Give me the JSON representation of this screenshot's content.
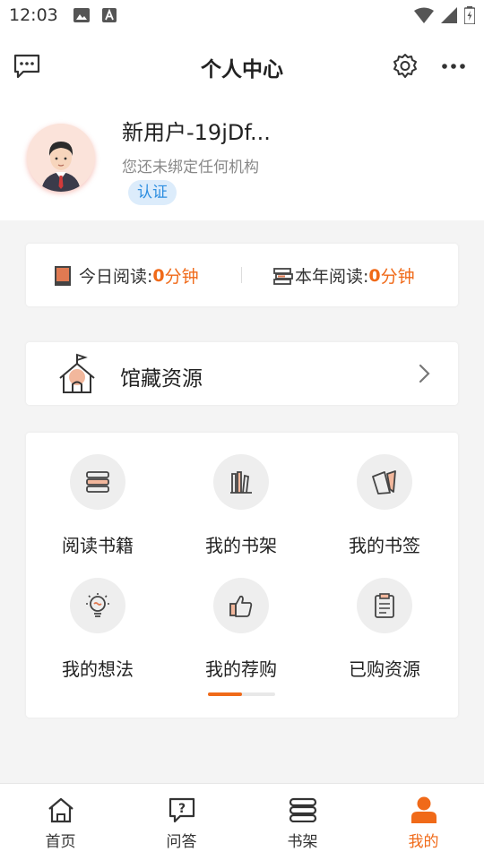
{
  "status_bar": {
    "time": "12:03"
  },
  "app_bar": {
    "title": "个人中心"
  },
  "profile": {
    "name": "新用户-19jDf...",
    "subtitle": "您还未绑定任何机构",
    "badge": "认证"
  },
  "reading": {
    "today_label": "今日阅读: ",
    "today_value": "0",
    "today_unit": "分钟",
    "year_label": "本年阅读: ",
    "year_value": "0",
    "year_unit": "分钟"
  },
  "library": {
    "label": "馆藏资源"
  },
  "grid": {
    "items": [
      {
        "label": "阅读书籍",
        "icon": "books-stack-icon"
      },
      {
        "label": "我的书架",
        "icon": "bookshelf-icon"
      },
      {
        "label": "我的书签",
        "icon": "bookmark-icon"
      },
      {
        "label": "我的想法",
        "icon": "lightbulb-icon"
      },
      {
        "label": "我的荐购",
        "icon": "thumbs-up-icon"
      },
      {
        "label": "已购资源",
        "icon": "clipboard-icon"
      }
    ],
    "page": 1,
    "page_count": 2
  },
  "tabs": [
    {
      "label": "首页",
      "icon": "home-icon"
    },
    {
      "label": "问答",
      "icon": "question-chat-icon"
    },
    {
      "label": "书架",
      "icon": "bookshelf-tab-icon"
    },
    {
      "label": "我的",
      "icon": "person-icon",
      "active": true
    }
  ],
  "colors": {
    "accent": "#f06a19",
    "badge_text": "#2d8ee0",
    "badge_bg": "#dcecfb"
  }
}
